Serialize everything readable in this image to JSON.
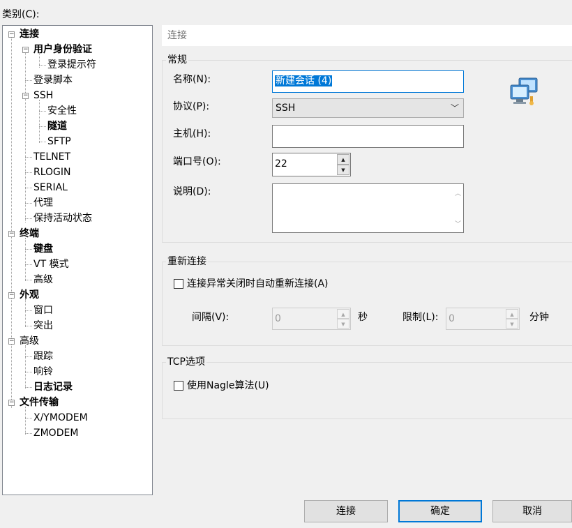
{
  "category_label": "类别(C):",
  "tree": [
    {
      "label": "连接",
      "bold": true
    },
    {
      "label": "用户身份验证",
      "bold": true
    },
    {
      "label": "登录提示符",
      "bold": false
    },
    {
      "label": "登录脚本",
      "bold": false
    },
    {
      "label": "SSH",
      "bold": false
    },
    {
      "label": "安全性",
      "bold": false
    },
    {
      "label": "隧道",
      "bold": true
    },
    {
      "label": "SFTP",
      "bold": false
    },
    {
      "label": "TELNET",
      "bold": false
    },
    {
      "label": "RLOGIN",
      "bold": false
    },
    {
      "label": "SERIAL",
      "bold": false
    },
    {
      "label": "代理",
      "bold": false
    },
    {
      "label": "保持活动状态",
      "bold": false
    },
    {
      "label": "终端",
      "bold": true
    },
    {
      "label": "键盘",
      "bold": true
    },
    {
      "label": "VT 模式",
      "bold": false
    },
    {
      "label": "高级",
      "bold": false
    },
    {
      "label": "外观",
      "bold": true
    },
    {
      "label": "窗口",
      "bold": false
    },
    {
      "label": "突出",
      "bold": false
    },
    {
      "label": "高级",
      "bold": false
    },
    {
      "label": "跟踪",
      "bold": false
    },
    {
      "label": "响铃",
      "bold": false
    },
    {
      "label": "日志记录",
      "bold": true
    },
    {
      "label": "文件传输",
      "bold": true
    },
    {
      "label": "X/YMODEM",
      "bold": false
    },
    {
      "label": "ZMODEM",
      "bold": false
    }
  ],
  "panel_header": "连接",
  "general": {
    "title": "常规",
    "name_label": "名称(N):",
    "name_value": "新建会话 (4)",
    "protocol_label": "协议(P):",
    "protocol_value": "SSH",
    "host_label": "主机(H):",
    "host_value": "",
    "port_label": "端口号(O):",
    "port_value": "22",
    "desc_label": "说明(D):",
    "desc_value": ""
  },
  "reconnect": {
    "title": "重新连接",
    "auto_label": "连接异常关闭时自动重新连接(A)",
    "interval_label": "间隔(V):",
    "interval_value": "0",
    "interval_unit": "秒",
    "limit_label": "限制(L):",
    "limit_value": "0",
    "limit_unit": "分钟"
  },
  "tcp": {
    "title": "TCP选项",
    "nagle_label": "使用Nagle算法(U)"
  },
  "buttons": {
    "connect": "连接",
    "ok": "确定",
    "cancel": "取消"
  },
  "icons": {
    "session_icon": "network-computers-icon"
  }
}
